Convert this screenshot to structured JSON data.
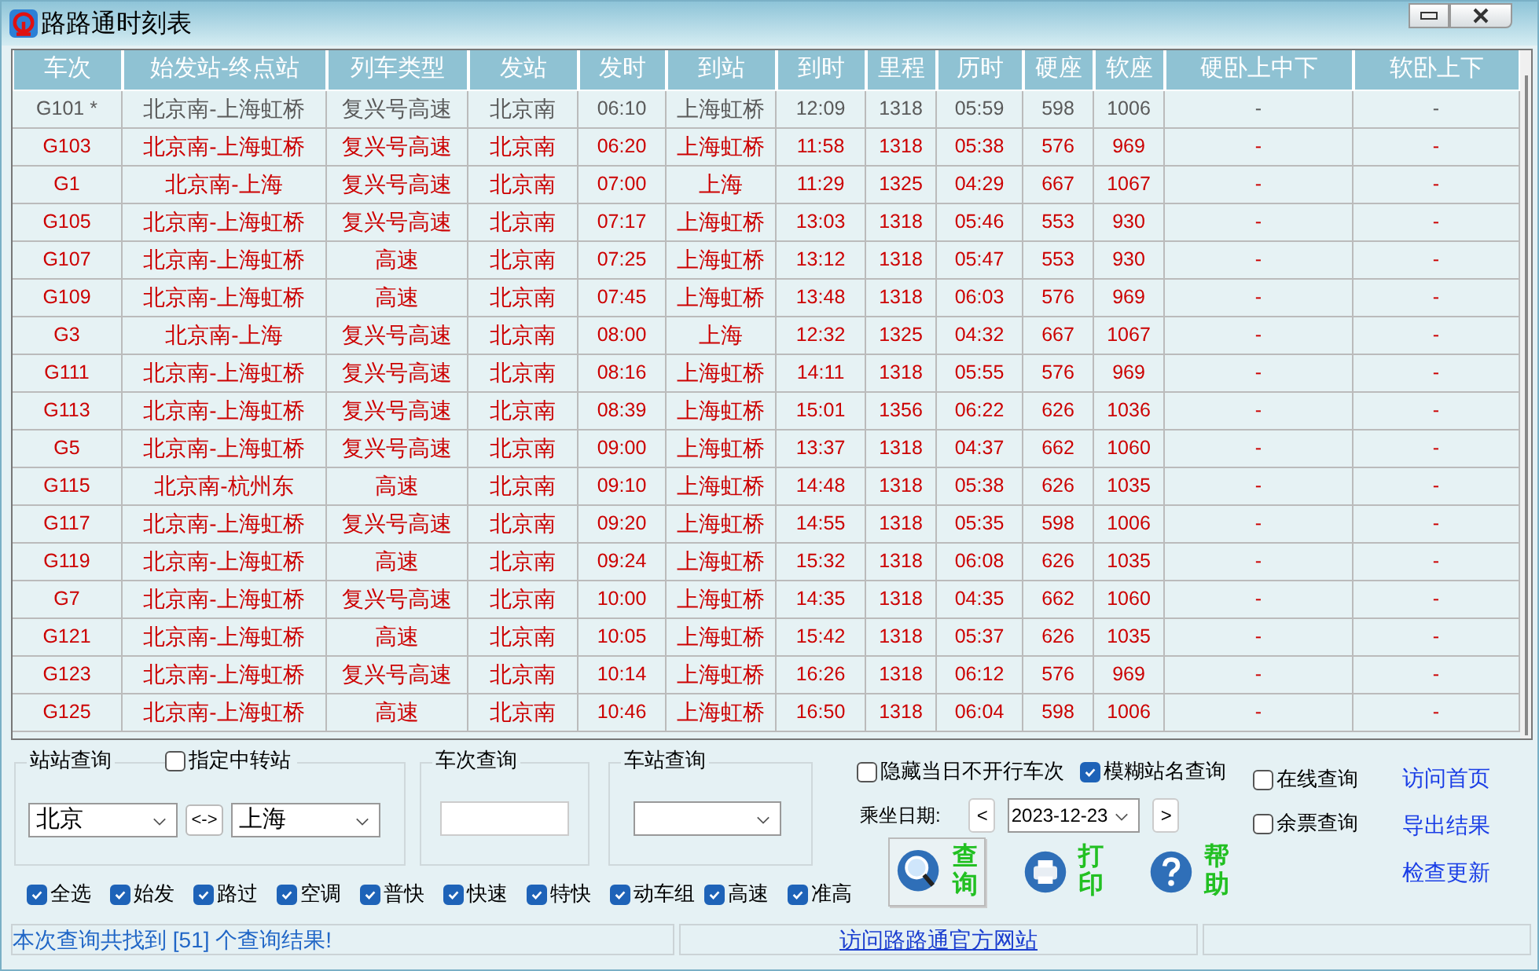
{
  "window": {
    "title": "路路通时刻表"
  },
  "table": {
    "columns": [
      "车次",
      "始发站-终点站",
      "列车类型",
      "发站",
      "发时",
      "到站",
      "到时",
      "里程",
      "历时",
      "硬座",
      "软座",
      "硬卧上中下",
      "软卧上下"
    ],
    "rows": [
      {
        "greyed": true,
        "cells": [
          "G101 *",
          "北京南-上海虹桥",
          "复兴号高速",
          "北京南",
          "06:10",
          "上海虹桥",
          "12:09",
          "1318",
          "05:59",
          "598",
          "1006",
          "-",
          "-"
        ]
      },
      {
        "greyed": false,
        "cells": [
          "G103",
          "北京南-上海虹桥",
          "复兴号高速",
          "北京南",
          "06:20",
          "上海虹桥",
          "11:58",
          "1318",
          "05:38",
          "576",
          "969",
          "-",
          "-"
        ]
      },
      {
        "greyed": false,
        "cells": [
          "G1",
          "北京南-上海",
          "复兴号高速",
          "北京南",
          "07:00",
          "上海",
          "11:29",
          "1325",
          "04:29",
          "667",
          "1067",
          "-",
          "-"
        ]
      },
      {
        "greyed": false,
        "cells": [
          "G105",
          "北京南-上海虹桥",
          "复兴号高速",
          "北京南",
          "07:17",
          "上海虹桥",
          "13:03",
          "1318",
          "05:46",
          "553",
          "930",
          "-",
          "-"
        ]
      },
      {
        "greyed": false,
        "cells": [
          "G107",
          "北京南-上海虹桥",
          "高速",
          "北京南",
          "07:25",
          "上海虹桥",
          "13:12",
          "1318",
          "05:47",
          "553",
          "930",
          "-",
          "-"
        ]
      },
      {
        "greyed": false,
        "cells": [
          "G109",
          "北京南-上海虹桥",
          "高速",
          "北京南",
          "07:45",
          "上海虹桥",
          "13:48",
          "1318",
          "06:03",
          "576",
          "969",
          "-",
          "-"
        ]
      },
      {
        "greyed": false,
        "cells": [
          "G3",
          "北京南-上海",
          "复兴号高速",
          "北京南",
          "08:00",
          "上海",
          "12:32",
          "1325",
          "04:32",
          "667",
          "1067",
          "-",
          "-"
        ]
      },
      {
        "greyed": false,
        "cells": [
          "G111",
          "北京南-上海虹桥",
          "复兴号高速",
          "北京南",
          "08:16",
          "上海虹桥",
          "14:11",
          "1318",
          "05:55",
          "576",
          "969",
          "-",
          "-"
        ]
      },
      {
        "greyed": false,
        "cells": [
          "G113",
          "北京南-上海虹桥",
          "复兴号高速",
          "北京南",
          "08:39",
          "上海虹桥",
          "15:01",
          "1356",
          "06:22",
          "626",
          "1036",
          "-",
          "-"
        ]
      },
      {
        "greyed": false,
        "cells": [
          "G5",
          "北京南-上海虹桥",
          "复兴号高速",
          "北京南",
          "09:00",
          "上海虹桥",
          "13:37",
          "1318",
          "04:37",
          "662",
          "1060",
          "-",
          "-"
        ]
      },
      {
        "greyed": false,
        "cells": [
          "G115",
          "北京南-杭州东",
          "高速",
          "北京南",
          "09:10",
          "上海虹桥",
          "14:48",
          "1318",
          "05:38",
          "626",
          "1035",
          "-",
          "-"
        ]
      },
      {
        "greyed": false,
        "cells": [
          "G117",
          "北京南-上海虹桥",
          "复兴号高速",
          "北京南",
          "09:20",
          "上海虹桥",
          "14:55",
          "1318",
          "05:35",
          "598",
          "1006",
          "-",
          "-"
        ]
      },
      {
        "greyed": false,
        "cells": [
          "G119",
          "北京南-上海虹桥",
          "高速",
          "北京南",
          "09:24",
          "上海虹桥",
          "15:32",
          "1318",
          "06:08",
          "626",
          "1035",
          "-",
          "-"
        ]
      },
      {
        "greyed": false,
        "cells": [
          "G7",
          "北京南-上海虹桥",
          "复兴号高速",
          "北京南",
          "10:00",
          "上海虹桥",
          "14:35",
          "1318",
          "04:35",
          "662",
          "1060",
          "-",
          "-"
        ]
      },
      {
        "greyed": false,
        "cells": [
          "G121",
          "北京南-上海虹桥",
          "高速",
          "北京南",
          "10:05",
          "上海虹桥",
          "15:42",
          "1318",
          "05:37",
          "626",
          "1035",
          "-",
          "-"
        ]
      },
      {
        "greyed": false,
        "cells": [
          "G123",
          "北京南-上海虹桥",
          "复兴号高速",
          "北京南",
          "10:14",
          "上海虹桥",
          "16:26",
          "1318",
          "06:12",
          "576",
          "969",
          "-",
          "-"
        ]
      },
      {
        "greyed": false,
        "cells": [
          "G125",
          "北京南-上海虹桥",
          "高速",
          "北京南",
          "10:46",
          "上海虹桥",
          "16:50",
          "1318",
          "06:04",
          "598",
          "1006",
          "-",
          "-"
        ]
      }
    ]
  },
  "station_query": {
    "label": "站站查询",
    "via": {
      "label": "指定中转站",
      "checked": false
    },
    "from": "北京",
    "swap": "<->",
    "to": "上海"
  },
  "train_query": {
    "label": "车次查询"
  },
  "stop_query": {
    "label": "车站查询"
  },
  "filters": [
    {
      "label": "全选",
      "checked": true
    },
    {
      "label": "始发",
      "checked": true
    },
    {
      "label": "路过",
      "checked": true
    },
    {
      "label": "空调",
      "checked": true
    },
    {
      "label": "普快",
      "checked": true
    },
    {
      "label": "快速",
      "checked": true
    },
    {
      "label": "特快",
      "checked": true
    },
    {
      "label": "动车组",
      "checked": true
    },
    {
      "label": "高速",
      "checked": true
    },
    {
      "label": "准高",
      "checked": true
    }
  ],
  "options": [
    {
      "label": "隐藏当日不开行车次",
      "checked": false
    },
    {
      "label": "模糊站名查询",
      "checked": true
    }
  ],
  "date": {
    "label": "乘坐日期:",
    "prev": "<",
    "value": "2023-12-23",
    "next": ">"
  },
  "actions": [
    {
      "label": "查询",
      "kind": "search",
      "selected": true
    },
    {
      "label": "打印",
      "kind": "print",
      "selected": false
    },
    {
      "label": "帮助",
      "kind": "help",
      "selected": false
    }
  ],
  "online_options": [
    {
      "label": "在线查询",
      "checked": false
    },
    {
      "label": "余票查询",
      "checked": false
    }
  ],
  "links": [
    "访问首页",
    "导出结果",
    "检查更新"
  ],
  "status_bar": {
    "message": "本次查询共找到 [51] 个查询结果!",
    "link": "访问路路通官方网站"
  }
}
